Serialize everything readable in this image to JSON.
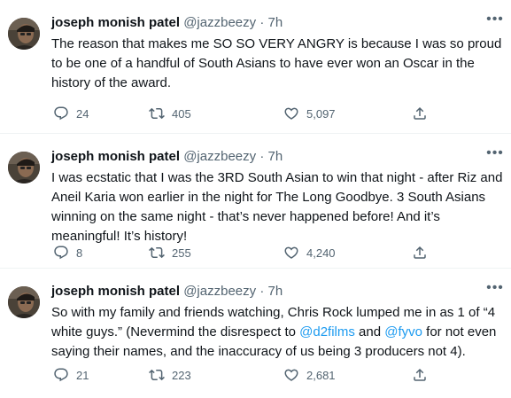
{
  "tweets": [
    {
      "author": {
        "name": "joseph monish patel",
        "handle": "@jazzbeezy",
        "time": "7h"
      },
      "text": "The reason that makes me SO SO VERY ANGRY is because I was so proud to be one of a handful of South Asians to have ever won an Oscar in the history of the award.",
      "stats": {
        "replies": "24",
        "retweets": "405",
        "likes": "5,097"
      }
    },
    {
      "author": {
        "name": "joseph monish patel",
        "handle": "@jazzbeezy",
        "time": "7h"
      },
      "text": "I was ecstatic that I was the 3RD South Asian to win that night - after Riz and Aneil Karia won earlier in the night for The Long Goodbye. 3 South Asians winning on the same night - that’s never happened before! And it’s meaningful! It’s history!",
      "stats": {
        "replies": "8",
        "retweets": "255",
        "likes": "4,240"
      }
    },
    {
      "author": {
        "name": "joseph monish patel",
        "handle": "@jazzbeezy",
        "time": "7h"
      },
      "text_parts": [
        "So with my family and friends watching, Chris Rock lumped me in as 1 of “4 white guys.” (Nevermind the disrespect to ",
        "@d2films",
        " and ",
        "@fyvo",
        " for not even saying their names, and the inaccuracy of us being 3 producers not 4)."
      ],
      "stats": {
        "replies": "21",
        "retweets": "223",
        "likes": "2,681"
      }
    }
  ],
  "separator": "·",
  "more_glyph": "•••",
  "colors": {
    "text": "#0f1419",
    "secondary": "#536471",
    "link": "#1d9bf0",
    "divider": "#eff3f4"
  },
  "icons": [
    "reply-icon",
    "retweet-icon",
    "like-icon",
    "share-icon",
    "more-icon"
  ]
}
